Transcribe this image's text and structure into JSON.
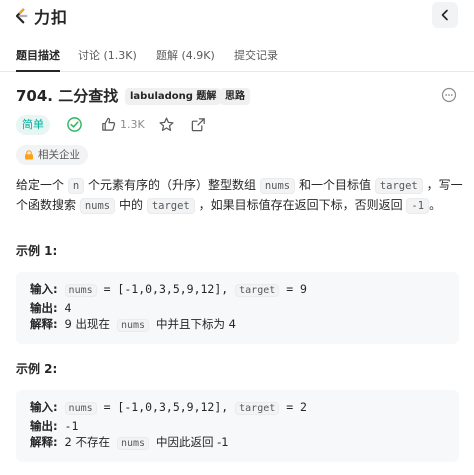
{
  "header": {
    "logo_text": "力扣",
    "brand_color": "#ffa116"
  },
  "tabs": [
    {
      "label": "题目描述"
    },
    {
      "label": "讨论 (1.3K)"
    },
    {
      "label": "题解 (4.9K)"
    },
    {
      "label": "提交记录"
    }
  ],
  "problem": {
    "title": "704. 二分查找",
    "tags": [
      "labuladong 题解",
      "思路"
    ],
    "difficulty": "简单",
    "difficulty_color": "#00af9b",
    "likes": "1.3K",
    "company_tag": "相关企业"
  },
  "description": {
    "p1": "给定一个",
    "c1": "n",
    "p2": "个元素有序的（升序）整型数组",
    "c2": "nums",
    "p3": "和一个目标值",
    "c3": "target",
    "p4": "，写一个函数搜索",
    "c4": "nums",
    "p5": "中的",
    "c5": "target",
    "p6": "，如果目标值存在返回下标，否则返回",
    "c6": "-1",
    "p7": "。"
  },
  "examples": [
    {
      "title": "示例 1:",
      "input_label": "输入:",
      "input_var1": "nums",
      "input_eq1": "= [-1,0,3,5,9,12],",
      "input_var2": "target",
      "input_eq2": "= 9",
      "output_label": "输出:",
      "output_value": "4",
      "explain_label": "解释:",
      "explain_pre": "9 出现在",
      "explain_code": "nums",
      "explain_post": "中并且下标为 4"
    },
    {
      "title": "示例 2:",
      "input_label": "输入:",
      "input_var1": "nums",
      "input_eq1": "= [-1,0,3,5,9,12],",
      "input_var2": "target",
      "input_eq2": "= 2",
      "output_label": "输出:",
      "output_value": "-1",
      "explain_label": "解释:",
      "explain_pre": "2 不存在",
      "explain_code": "nums",
      "explain_post": "中因此返回 -1"
    }
  ]
}
